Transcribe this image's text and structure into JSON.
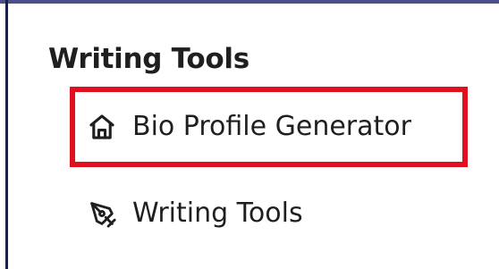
{
  "sidebar": {
    "section_title": "Writing Tools",
    "items": [
      {
        "label": "Bio Profile Generator",
        "icon": "home-icon",
        "active": true,
        "highlight_color": "#e1101f"
      },
      {
        "label": "Writing Tools",
        "icon": "pen-tool-icon",
        "active": false
      }
    ]
  },
  "colors": {
    "text": "#1f1f1f",
    "frame_top": "#4b4f8c",
    "frame_left": "#1c1f4a",
    "highlight": "#e1101f"
  }
}
